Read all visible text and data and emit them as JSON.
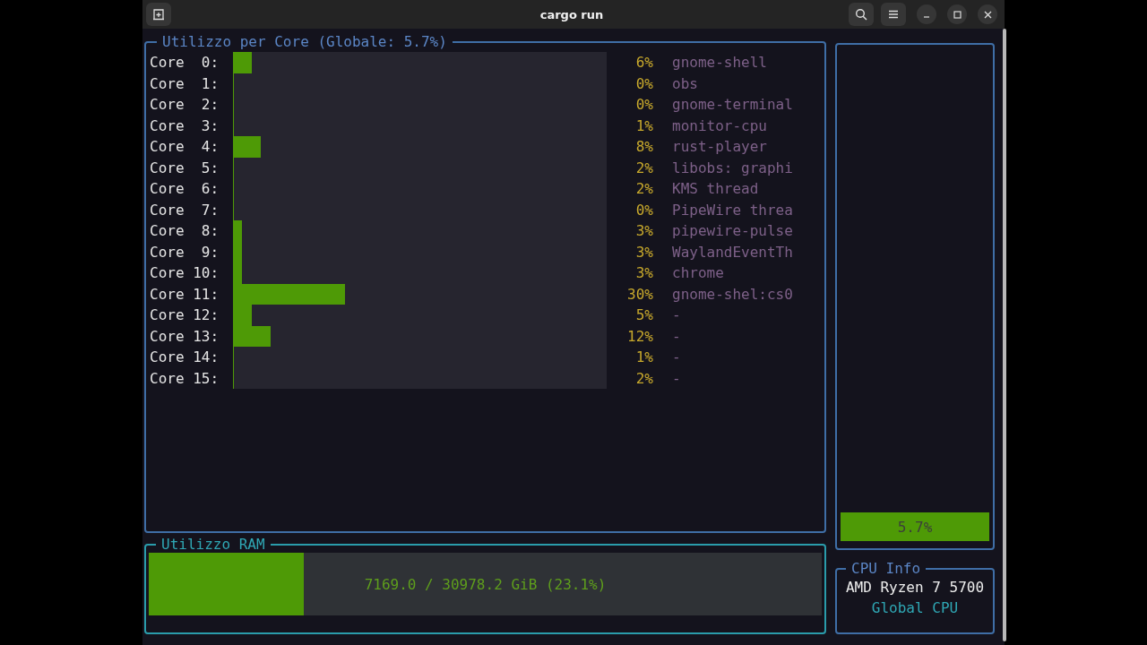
{
  "window": {
    "title": "cargo run"
  },
  "core_panel": {
    "title": "Utilizzo per Core (Globale: 5.7%)",
    "cores": [
      {
        "label": "Core  0:",
        "level": 0.05,
        "percent": "6%",
        "process": "gnome-shell"
      },
      {
        "label": "Core  1:",
        "level": 0,
        "percent": "0%",
        "process": "obs"
      },
      {
        "label": "Core  2:",
        "level": 0,
        "percent": "0%",
        "process": "gnome-terminal"
      },
      {
        "label": "Core  3:",
        "level": 0,
        "percent": "1%",
        "process": "monitor-cpu"
      },
      {
        "label": "Core  4:",
        "level": 0.075,
        "percent": "8%",
        "process": "rust-player"
      },
      {
        "label": "Core  5:",
        "level": 0,
        "percent": "2%",
        "process": "libobs: graphi"
      },
      {
        "label": "Core  6:",
        "level": 0,
        "percent": "2%",
        "process": "KMS thread"
      },
      {
        "label": "Core  7:",
        "level": 0,
        "percent": "0%",
        "process": "PipeWire threa"
      },
      {
        "label": "Core  8:",
        "level": 0.025,
        "percent": "3%",
        "process": "pipewire-pulse"
      },
      {
        "label": "Core  9:",
        "level": 0.025,
        "percent": "3%",
        "process": "WaylandEventTh"
      },
      {
        "label": "Core 10:",
        "level": 0.025,
        "percent": "3%",
        "process": "chrome"
      },
      {
        "label": "Core 11:",
        "level": 0.3,
        "percent": "30%",
        "process": "gnome-shel:cs0"
      },
      {
        "label": "Core 12:",
        "level": 0.05,
        "percent": "5%",
        "process": "-"
      },
      {
        "label": "Core 13:",
        "level": 0.1,
        "percent": "12%",
        "process": "-"
      },
      {
        "label": "Core 14:",
        "level": 0,
        "percent": "1%",
        "process": "-"
      },
      {
        "label": "Core 15:",
        "level": 0,
        "percent": "2%",
        "process": "-"
      }
    ]
  },
  "cpu_gauge": {
    "level": 0.057,
    "label": "5.7%"
  },
  "ram_panel": {
    "title": "Utilizzo RAM",
    "level": 0.231,
    "label": "7169.0 / 30978.2 GiB (23.1%)"
  },
  "cpu_info": {
    "title": "CPU Info",
    "model": "AMD Ryzen 7 5700",
    "caption": "Global CPU"
  }
}
